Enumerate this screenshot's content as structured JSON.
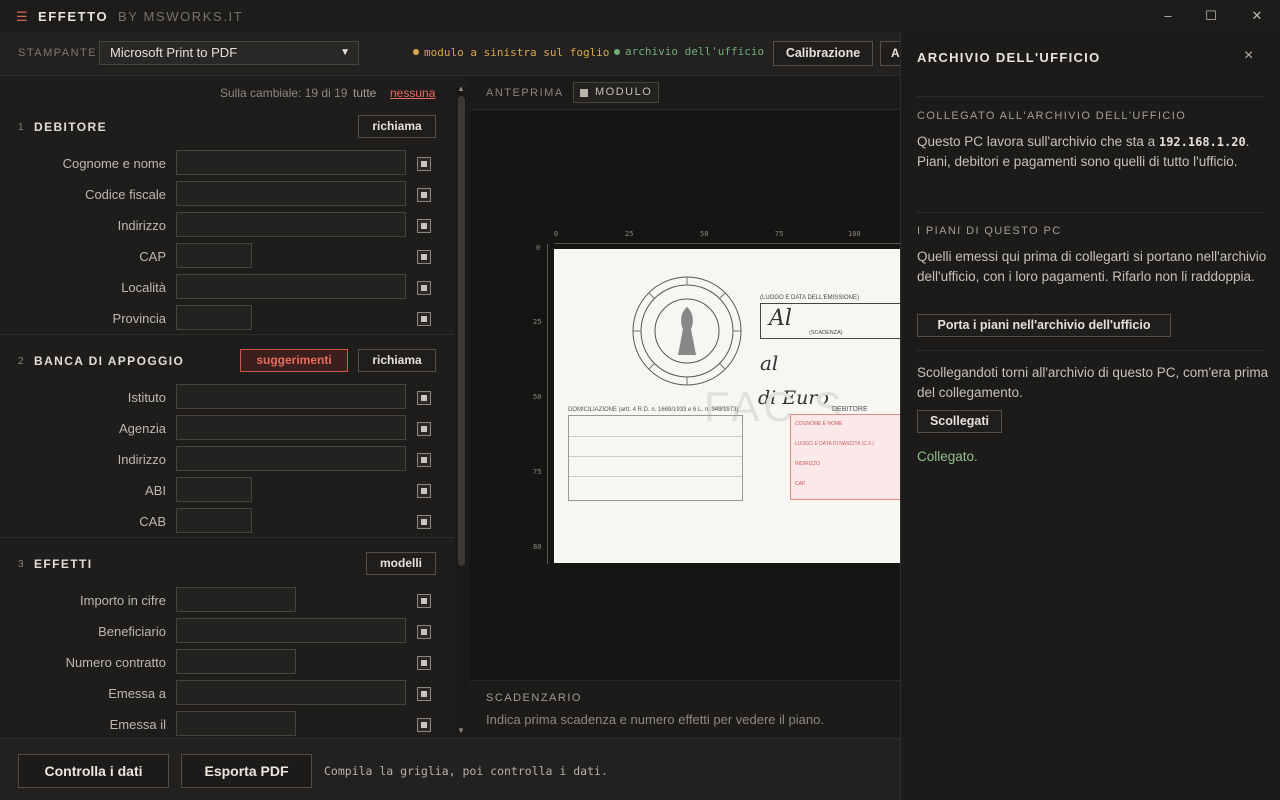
{
  "app": {
    "menu_glyph": "☰",
    "brand": "EFFETTO",
    "by": "BY MSWORKS.IT",
    "window_controls": [
      "–",
      "☐",
      "✕"
    ]
  },
  "toolbar": {
    "printer_label": "STAMPANTE",
    "printer_value": "Microsoft Print to PDF",
    "status_left": "modulo a sinistra sul foglio",
    "status_right": "archivio dell'ufficio",
    "status_left_color": "#d8a84a",
    "status_right_color": "#6fae78",
    "calibrazione": "Calibrazione",
    "next_button_partial": "A"
  },
  "left": {
    "summary": "Sulla cambiale: 19 di 19",
    "all": "tutte",
    "none": "nessuna",
    "sections": [
      {
        "num": "1",
        "title": "DEBITORE",
        "buttons": [
          "richiama"
        ],
        "fields": [
          "Cognome e nome",
          "Codice fiscale",
          "Indirizzo",
          "CAP",
          "Località",
          "Provincia"
        ]
      },
      {
        "num": "2",
        "title": "BANCA DI APPOGGIO",
        "buttons": [
          "suggerimenti",
          "richiama"
        ],
        "fields": [
          "Istituto",
          "Agenzia",
          "Indirizzo",
          "ABI",
          "CAB"
        ]
      },
      {
        "num": "3",
        "title": "EFFETTI",
        "buttons": [
          "modelli"
        ],
        "fields": [
          "Importo in cifre",
          "Beneficiario",
          "Numero contratto",
          "Emessa a",
          "Emessa il"
        ]
      }
    ]
  },
  "preview": {
    "label": "ANTEPRIMA",
    "toggle": "MODULO",
    "ruler_top": [
      "0",
      "25",
      "50",
      "75",
      "100"
    ],
    "ruler_left": [
      "0",
      "25",
      "50",
      "75",
      "80"
    ],
    "form_text": {
      "luogo": "(LUOGO E DATA DELL'EMISSIONE)",
      "al": "Al",
      "scadenza": "(SCADENZA)",
      "al2": "al",
      "di_euro": "di Euro",
      "fac": "FAC S",
      "domiciliazione": "DOMICILIAZIONE (artt. 4 R.D. n. 1669/1933 e 6 L. n. 349/1973)",
      "debitore": "DEBITORE",
      "cognome": "COGNOME E NOME",
      "luogo_nascita": "LUOGO E DATA DI NASCITA (C.F.)",
      "indirizzo": "INDIRIZZO",
      "cap": "CAP"
    }
  },
  "scadenzario": {
    "title": "SCADENZARIO",
    "text": "Indica prima scadenza e numero effetti per vedere il piano."
  },
  "bottom": {
    "check": "Controlla i dati",
    "export": "Esporta PDF",
    "hint": "Compila la griglia, poi controlla i dati."
  },
  "drawer": {
    "title": "ARCHIVIO DELL'UFFICIO",
    "close": "×",
    "s1_head": "COLLEGATO ALL'ARCHIVIO DELL'UFFICIO",
    "s1_text_a": "Questo PC lavora sull'archivio che sta a",
    "s1_ip": "192.168.1.20",
    "s1_text_b": ". Piani, debitori e pagamenti sono quelli di tutto l'ufficio.",
    "s2_head": "I PIANI DI QUESTO PC",
    "s2_text": "Quelli emessi qui prima di collegarti si portano nell'archivio dell'ufficio, con i loro pagamenti. Rifarlo non li raddoppia.",
    "s2_button": "Porta i piani nell'archivio dell'ufficio",
    "s3_text": "Scollegandoti torni all'archivio di questo PC, com'era prima del collegamento.",
    "s3_button": "Scollegati",
    "status": "Collegato.",
    "status_color": "#8fc08a"
  }
}
